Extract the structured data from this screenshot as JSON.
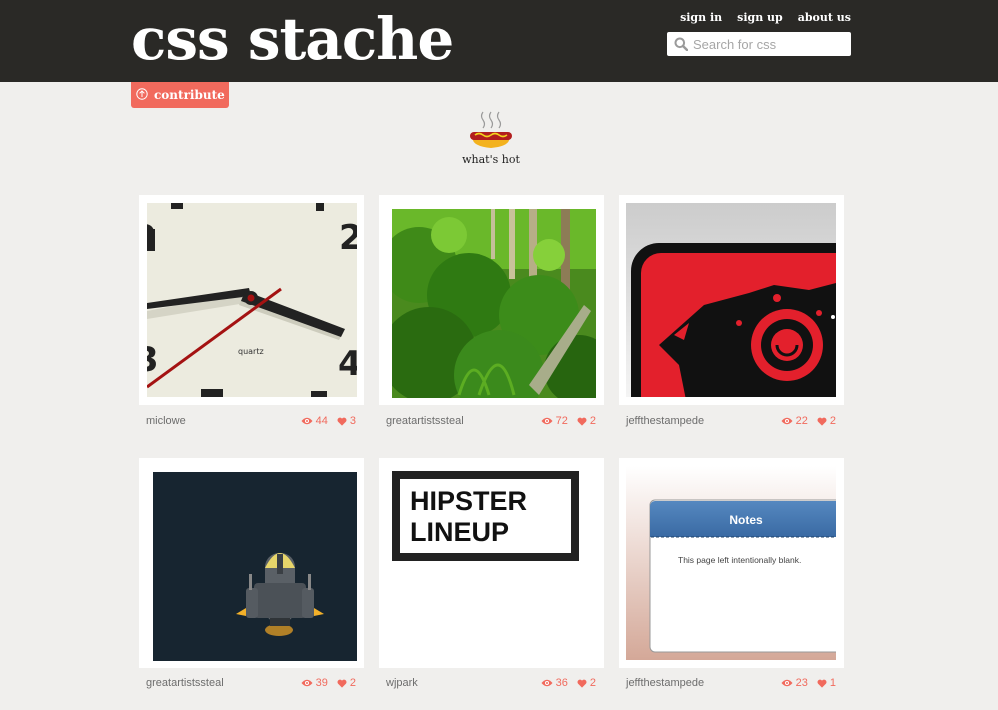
{
  "header": {
    "logo": "css stache",
    "nav": [
      {
        "label": "sign in"
      },
      {
        "label": "sign up"
      },
      {
        "label": "about us"
      }
    ],
    "search_placeholder": "Search for css"
  },
  "contribute_label": "contribute",
  "section_title": "what's hot",
  "cards": [
    {
      "author": "miclowe",
      "views": "44",
      "likes": "3",
      "thumb": "clock",
      "thumb_text": "quartz"
    },
    {
      "author": "greatartistssteal",
      "views": "72",
      "likes": "2",
      "thumb": "forest"
    },
    {
      "author": "jeffthestampede",
      "views": "22",
      "likes": "2",
      "thumb": "camera-logo"
    },
    {
      "author": "greatartistssteal",
      "views": "39",
      "likes": "2",
      "thumb": "spaceship"
    },
    {
      "author": "wjpark",
      "views": "36",
      "likes": "2",
      "thumb": "hipster-lineup",
      "thumb_lines": [
        "HIPSTER",
        "LINEUP"
      ]
    },
    {
      "author": "jeffthestampede",
      "views": "23",
      "likes": "1",
      "thumb": "notes-app",
      "thumb_title": "Notes",
      "thumb_body": "This page left intentionally blank."
    }
  ],
  "colors": {
    "header_bg": "#2a2926",
    "page_bg": "#f0efed",
    "accent": "#f16a5d"
  }
}
